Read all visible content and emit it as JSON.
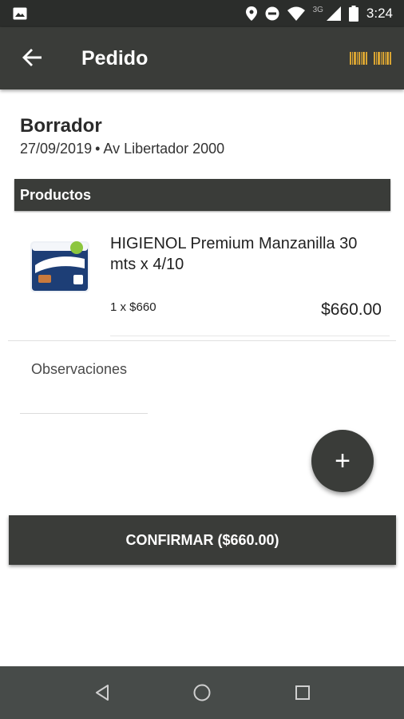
{
  "status_bar": {
    "time": "3:24",
    "network": "3G",
    "icons": [
      "image-icon",
      "location-icon",
      "do-not-disturb-icon",
      "wifi-icon",
      "signal-icon",
      "battery-icon"
    ]
  },
  "app_bar": {
    "title": "Pedido",
    "icons": [
      "back-arrow-icon",
      "barcode-icon"
    ]
  },
  "order": {
    "status": "Borrador",
    "date": "27/09/2019",
    "separator": "•",
    "address": "Av Libertador 2000"
  },
  "section_title": "Productos",
  "products": [
    {
      "name": "HIGIENOL Premium Manzanilla 30 mts x 4/10",
      "quantity_price": "1 x $660",
      "total": "$660.00",
      "image_icon": "toilet-paper-pack-image"
    }
  ],
  "observations": {
    "placeholder": "Observaciones"
  },
  "fab": {
    "label": "+"
  },
  "confirm": {
    "label": "CONFIRMAR ($660.00)"
  },
  "nav_bar": {
    "icons": [
      "back-triangle-icon",
      "home-circle-icon",
      "recents-square-icon"
    ]
  },
  "colors": {
    "status_bar": "#2b2d2b",
    "app_bar": "#3a3c39",
    "accent_barcode": "#d8a433",
    "nav_bar": "#474b49"
  }
}
